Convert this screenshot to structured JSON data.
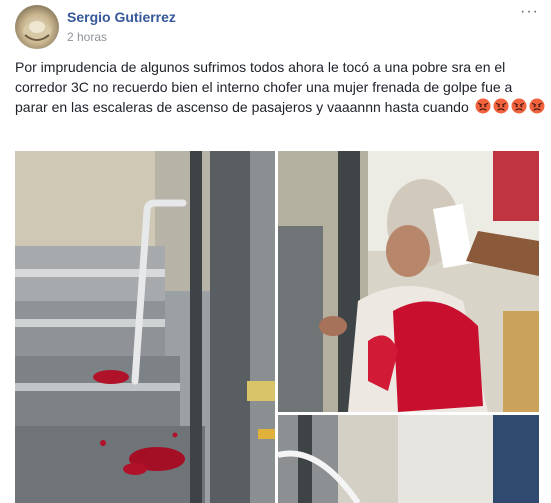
{
  "post": {
    "author": "Sergio Gutierrez",
    "time": "2 horas",
    "text": "Por imprudencia de algunos sufrimos todos ahora le tocó a una pobre sra en el corredor 3C no recuerdo bien el interno chofer una mujer frenada de golpe fue a parar en las escaleras de ascenso de pasajeros y vaaannn hasta cuando",
    "emoji_count": 4,
    "emoji_name": "angry-face-icon",
    "more_label": "···"
  },
  "colors": {
    "author": "#365899",
    "time": "#90949c",
    "text": "#1d2129",
    "blood": "#c8102e"
  }
}
